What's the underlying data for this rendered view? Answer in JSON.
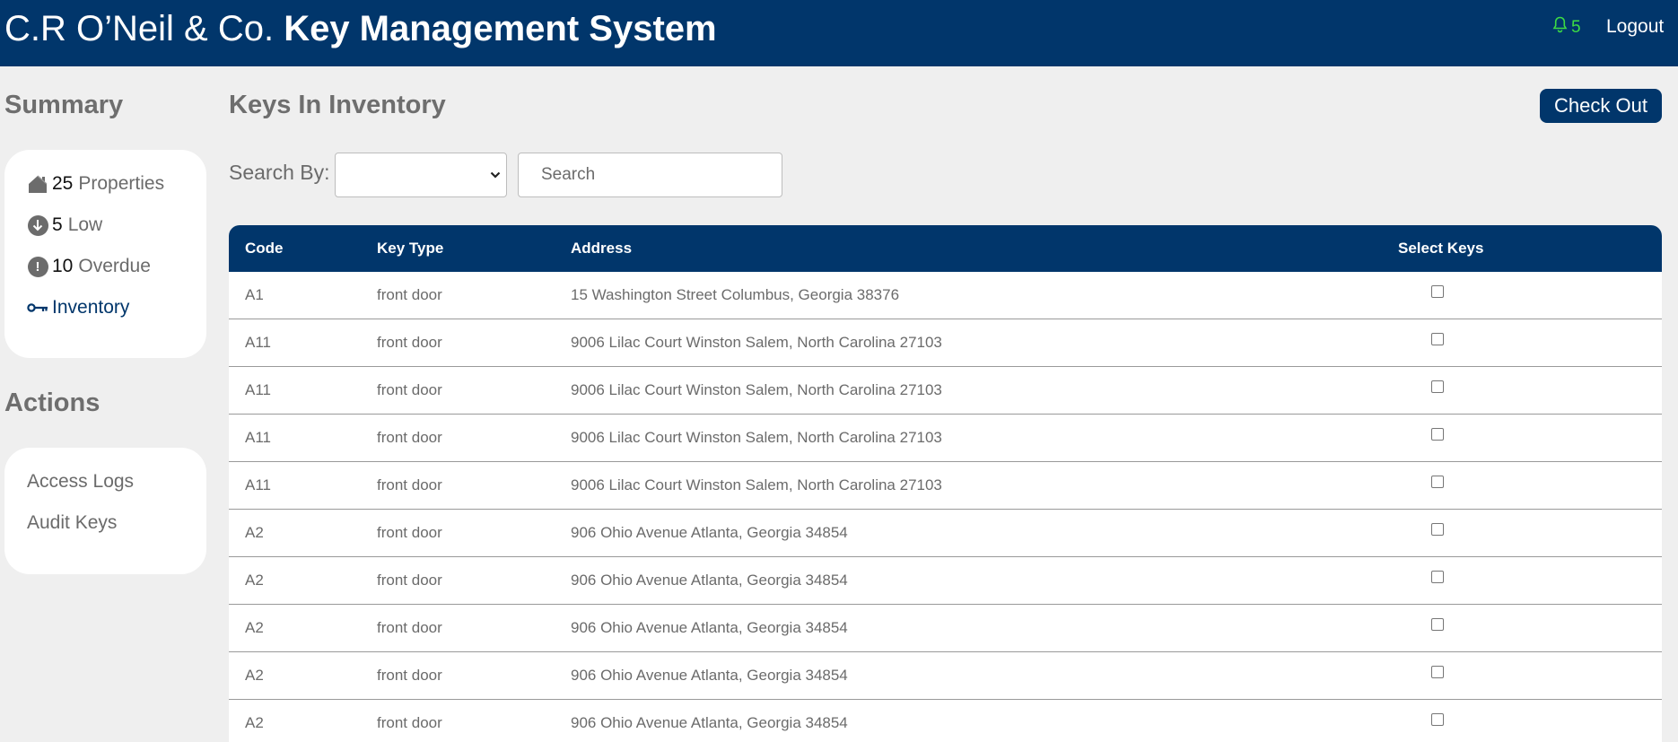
{
  "header": {
    "company": "C.R O’Neil & Co.",
    "app_name": "Key Management System",
    "notification_count": "5",
    "logout_label": "Logout"
  },
  "sidebar": {
    "summary_title": "Summary",
    "summary_items": [
      {
        "icon": "house-icon",
        "count": "25",
        "label": "Properties"
      },
      {
        "icon": "arrow-down-circle-icon",
        "count": "5",
        "label": "Low"
      },
      {
        "icon": "exclamation-circle-icon",
        "count": "10",
        "label": "Overdue"
      },
      {
        "icon": "key-icon",
        "count": "",
        "label": "Inventory"
      }
    ],
    "actions_title": "Actions",
    "actions": [
      "Access Logs",
      "Audit Keys"
    ]
  },
  "main": {
    "title": "Keys In Inventory",
    "checkout_label": "Check Out",
    "search_by_label": "Search By:",
    "search_by_value": "",
    "search_placeholder": "Search",
    "table": {
      "columns": [
        "Code",
        "Key Type",
        "Address",
        "Select Keys"
      ],
      "rows": [
        {
          "code": "A1",
          "key_type": "front door",
          "address": "15 Washington Street Columbus, Georgia 38376"
        },
        {
          "code": "A11",
          "key_type": "front door",
          "address": "9006 Lilac Court Winston Salem, North Carolina 27103"
        },
        {
          "code": "A11",
          "key_type": "front door",
          "address": "9006 Lilac Court Winston Salem, North Carolina 27103"
        },
        {
          "code": "A11",
          "key_type": "front door",
          "address": "9006 Lilac Court Winston Salem, North Carolina 27103"
        },
        {
          "code": "A11",
          "key_type": "front door",
          "address": "9006 Lilac Court Winston Salem, North Carolina 27103"
        },
        {
          "code": "A2",
          "key_type": "front door",
          "address": "906 Ohio Avenue Atlanta, Georgia 34854"
        },
        {
          "code": "A2",
          "key_type": "front door",
          "address": "906 Ohio Avenue Atlanta, Georgia 34854"
        },
        {
          "code": "A2",
          "key_type": "front door",
          "address": "906 Ohio Avenue Atlanta, Georgia 34854"
        },
        {
          "code": "A2",
          "key_type": "front door",
          "address": "906 Ohio Avenue Atlanta, Georgia 34854"
        },
        {
          "code": "A2",
          "key_type": "front door",
          "address": "906 Ohio Avenue Atlanta, Georgia 34854"
        }
      ]
    }
  },
  "colors": {
    "brand_navy": "#01366b",
    "notification_green": "#3ddc44",
    "background": "#efefef"
  }
}
